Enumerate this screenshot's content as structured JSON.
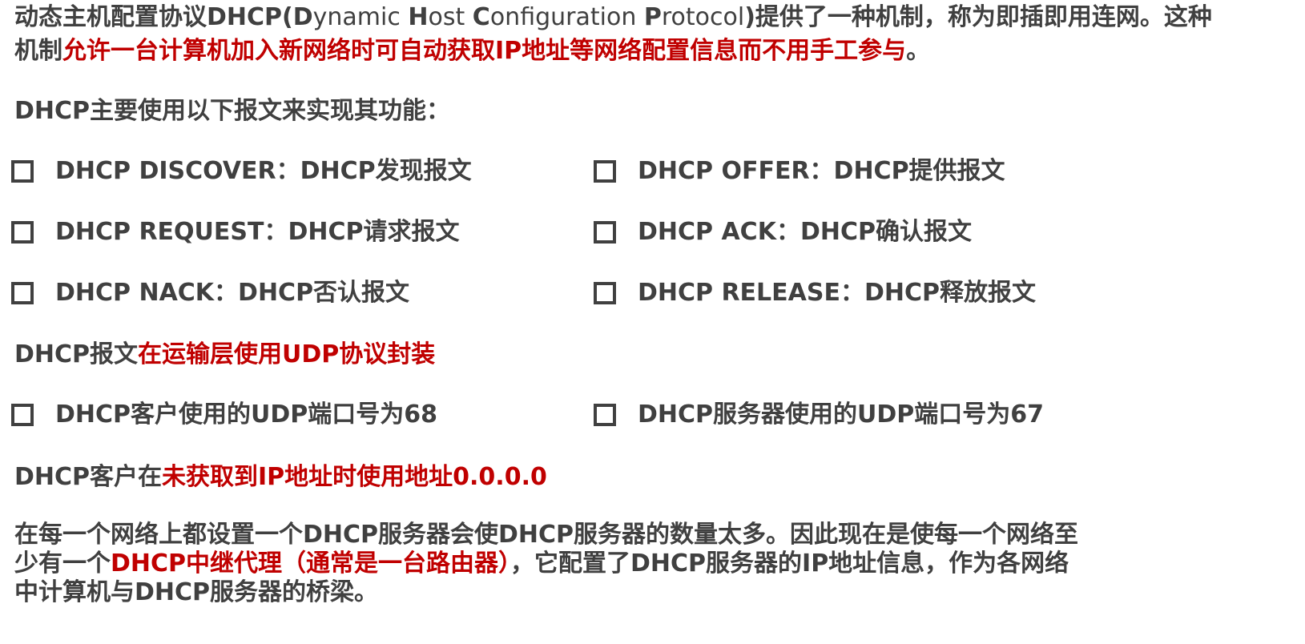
{
  "intro": {
    "line1_a": "动态主机配置协议DHCP(",
    "D": "D",
    "ynamic": "ynamic ",
    "H": "H",
    "ost": "ost ",
    "C": "C",
    "onfiguration": "onfiguration ",
    "P": "P",
    "rotocol": "rotocol",
    "line1_b": ")提供了一种机制，称为即插即用连网。这种",
    "line2_a": "机制",
    "line2_red": "允许一台计算机加入新网络时可自动获取IP地址等网络配置信息而不用手工参与",
    "line2_end": "。"
  },
  "messages_heading": "DHCP主要使用以下报文来实现其功能：",
  "messages": [
    {
      "text": "DHCP DISCOVER：DHCP发现报文"
    },
    {
      "text": "DHCP OFFER：DHCP提供报文"
    },
    {
      "text": "DHCP REQUEST：DHCP请求报文"
    },
    {
      "text": "DHCP ACK：DHCP确认报文"
    },
    {
      "text": "DHCP NACK：DHCP否认报文"
    },
    {
      "text": "DHCP RELEASE：DHCP释放报文"
    }
  ],
  "udp_line": {
    "a": "DHCP报文",
    "red": "在运输层使用UDP协议封装"
  },
  "ports": [
    {
      "text": "DHCP客户使用的UDP端口号为68"
    },
    {
      "text": "DHCP服务器使用的UDP端口号为67"
    }
  ],
  "addr_line": {
    "a": "DHCP客户在",
    "red": "未获取到IP地址时使用地址0.0.0.0"
  },
  "relay": {
    "line1": "在每一个网络上都设置一个DHCP服务器会使DHCP服务器的数量太多。因此现在是使每一个网络至",
    "line2_a": "少有一个",
    "line2_red": "DHCP中继代理（通常是一台路由器）",
    "line2_b": "，它配置了DHCP服务器的IP地址信息，作为各网络",
    "line3": "中计算机与DHCP服务器的桥梁。"
  },
  "colors": {
    "text": "#404040",
    "highlight": "#c00000"
  }
}
